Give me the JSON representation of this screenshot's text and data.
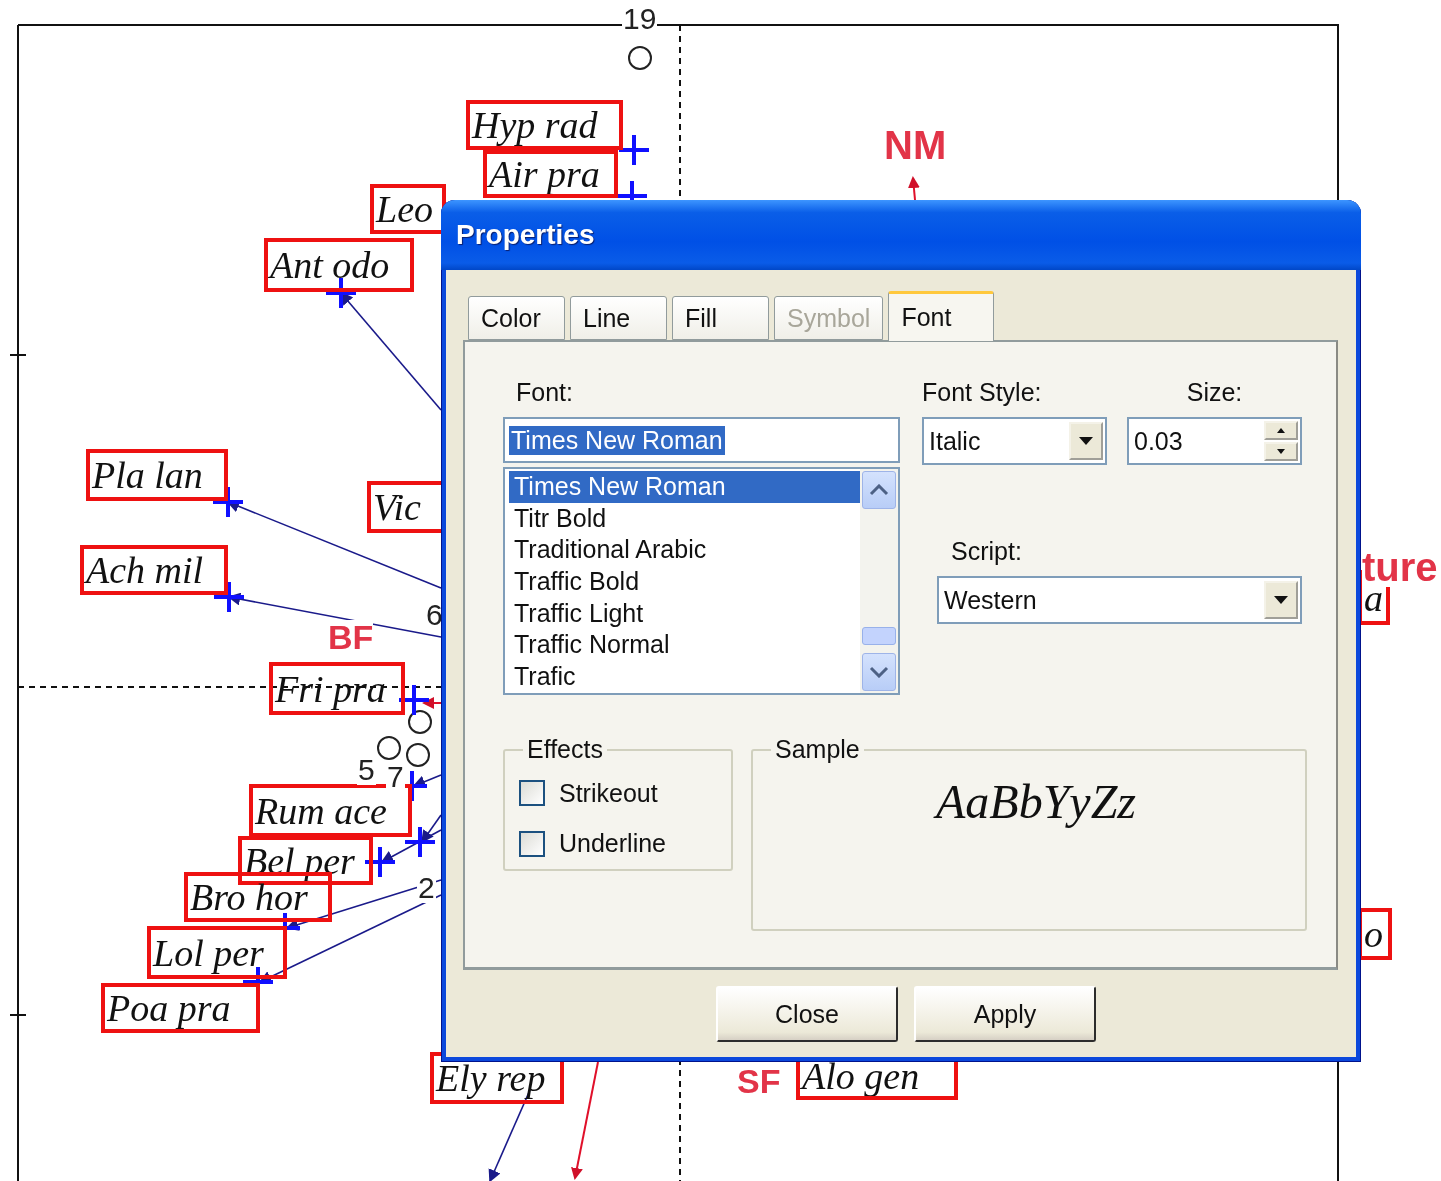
{
  "plot": {
    "species": [
      {
        "label": "Hyp rad",
        "selected": true
      },
      {
        "label": "Air pra",
        "selected": true
      },
      {
        "label": "Leo",
        "selected": true
      },
      {
        "label": "Ant odo",
        "selected": true
      },
      {
        "label": "Pla lan",
        "selected": true
      },
      {
        "label": "Vic",
        "selected": true
      },
      {
        "label": "Ach mil",
        "selected": true
      },
      {
        "label": "Fri pra",
        "selected": true
      },
      {
        "label": "Rum ace",
        "selected": true
      },
      {
        "label": "Bel per",
        "selected": true
      },
      {
        "label": "Bro hor",
        "selected": true
      },
      {
        "label": "Lol per",
        "selected": true
      },
      {
        "label": "Poa pra",
        "selected": true
      },
      {
        "label": "Ely rep",
        "selected": true
      },
      {
        "label": "Alo gen",
        "selected": true
      },
      {
        "label": "a",
        "selected": true
      },
      {
        "label": "o",
        "selected": true
      }
    ],
    "sample_numbers": [
      "19",
      "6",
      "5",
      "7",
      "2"
    ],
    "variables": [
      "NM",
      "BF",
      "ture",
      "SF"
    ]
  },
  "dialog": {
    "title": "Properties",
    "tabs": [
      {
        "label": "Color",
        "selected": false,
        "disabled": false
      },
      {
        "label": "Line",
        "selected": false,
        "disabled": false
      },
      {
        "label": "Fill",
        "selected": false,
        "disabled": false
      },
      {
        "label": "Symbol",
        "selected": false,
        "disabled": true
      },
      {
        "label": "Font",
        "selected": true,
        "disabled": false
      }
    ],
    "font": {
      "label": "Font:",
      "value": "Times New Roman",
      "items": [
        {
          "label": "Times New Roman",
          "selected": true
        },
        {
          "label": "Titr Bold",
          "selected": false
        },
        {
          "label": "Traditional Arabic",
          "selected": false
        },
        {
          "label": "Traffic Bold",
          "selected": false
        },
        {
          "label": "Traffic Light",
          "selected": false
        },
        {
          "label": "Traffic Normal",
          "selected": false
        },
        {
          "label": "Trafic",
          "selected": false
        }
      ]
    },
    "font_style": {
      "label": "Font Style:",
      "value": "Italic"
    },
    "size": {
      "label": "Size:",
      "value": "0.03"
    },
    "script": {
      "label": "Script:",
      "value": "Western"
    },
    "effects": {
      "title": "Effects",
      "options": [
        {
          "label": "Strikeout",
          "checked": false
        },
        {
          "label": "Underline",
          "checked": false
        }
      ]
    },
    "sample": {
      "title": "Sample",
      "text": "AaBbYyZz"
    },
    "buttons": [
      "Close",
      "Apply"
    ]
  }
}
